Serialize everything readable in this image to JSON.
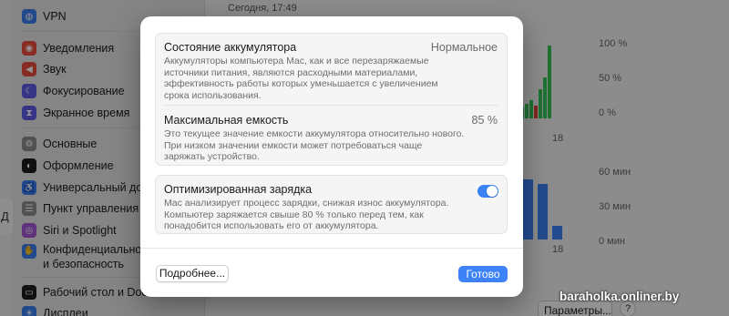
{
  "sidebar": {
    "items": [
      {
        "label": "VPN",
        "icon": "globe-icon",
        "color": "#3c7ef2"
      },
      {
        "label": "Уведомления",
        "icon": "bell-icon",
        "color": "#eb4d3d"
      },
      {
        "label": "Звук",
        "icon": "speaker-icon",
        "color": "#eb4d3d"
      },
      {
        "label": "Фокусирование",
        "icon": "moon-icon",
        "color": "#5e5ce6"
      },
      {
        "label": "Экранное время",
        "icon": "hourglass-icon",
        "color": "#5e5ce6"
      },
      {
        "label": "Основные",
        "icon": "gear-icon",
        "color": "#8e8e93"
      },
      {
        "label": "Оформление",
        "icon": "appearance-icon",
        "color": "#1c1c1e"
      },
      {
        "label": "Универсальный дос",
        "icon": "accessibility-icon",
        "color": "#3c7ef2"
      },
      {
        "label": "Пункт управления",
        "icon": "control-center-icon",
        "color": "#8e8e93"
      },
      {
        "label": "Siri и Spotlight",
        "icon": "siri-icon",
        "color": "#a455d6"
      },
      {
        "label": "Конфиденциальность\nи безопасность",
        "icon": "hand-icon",
        "color": "#3c7ef2"
      },
      {
        "label": "Рабочий стол и Dock",
        "icon": "desktop-icon",
        "color": "#1c1c1e"
      },
      {
        "label": "Дисплеи",
        "icon": "display-icon",
        "color": "#3c7ef2"
      }
    ],
    "left_edge_text": "Д"
  },
  "main": {
    "date": "Сегодня, 17:49",
    "level_axis": [
      "100 %",
      "50 %",
      "0 %"
    ],
    "time_axis": [
      "60 мин",
      "30 мин",
      "0 мин"
    ],
    "x_tick": "18",
    "params_button": "Параметры...",
    "help_button": "?"
  },
  "modal": {
    "battery_state_title": "Состояние аккумулятора",
    "battery_state_value": "Нормальное",
    "battery_state_desc": "Аккумуляторы компьютера Mac, как и все перезаряжаемые источники питания, являются расходными материалами, эффективность работы которых уменьшается с увеличением срока использования.",
    "max_capacity_title": "Максимальная емкость",
    "max_capacity_value": "85 %",
    "max_capacity_desc": "Это текущее значение емкости аккумулятора относительно нового. При низком значении емкости может потребоваться чаще заряжать устройство.",
    "optimized_title": "Оптимизированная зарядка",
    "optimized_desc": "Mac анализирует процесс зарядки, снижая износ аккумулятора. Компьютер заряжается свыше 80 % только перед тем, как понадобится использовать его от аккумулятора.",
    "optimized_enabled": true,
    "details_button": "Подробнее...",
    "done_button": "Готово"
  },
  "watermark": "baraholka.onliner.by",
  "colors": {
    "accent": "#3d82f7",
    "green_bar": "#34c759",
    "red_bar": "#e0443a"
  }
}
